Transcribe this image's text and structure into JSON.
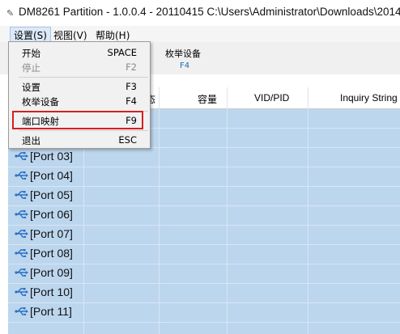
{
  "window": {
    "title": "DM8261 Partition - 1.0.0.4 - 20110415  C:\\Users\\Administrator\\Downloads\\2014"
  },
  "menubar": {
    "items": [
      {
        "label": "设置(S)"
      },
      {
        "label": "视图(V)"
      },
      {
        "label": "帮助(H)"
      }
    ]
  },
  "toolbar": {
    "enumerate_label": "枚举设备",
    "enumerate_key": "F4"
  },
  "settings_menu": {
    "items": [
      {
        "label": "开始",
        "shortcut": "SPACE",
        "enabled": true
      },
      {
        "label": "停止",
        "shortcut": "F2",
        "enabled": false
      },
      {
        "label": "设置",
        "shortcut": "F3",
        "enabled": true
      },
      {
        "label": "枚举设备",
        "shortcut": "F4",
        "enabled": true
      },
      {
        "label": "端口映射",
        "shortcut": "F9",
        "enabled": true,
        "highlighted": true
      },
      {
        "label": "退出",
        "shortcut": "ESC",
        "enabled": true
      }
    ]
  },
  "table": {
    "columns": [
      "态",
      "容量",
      "VID/PID",
      "Inquiry String"
    ],
    "rows": [
      {
        "port": "[Port 03]"
      },
      {
        "port": "[Port 04]"
      },
      {
        "port": "[Port 05]"
      },
      {
        "port": "[Port 06]"
      },
      {
        "port": "[Port 07]"
      },
      {
        "port": "[Port 08]"
      },
      {
        "port": "[Port 09]"
      },
      {
        "port": "[Port 10]"
      },
      {
        "port": "[Port 11]"
      }
    ]
  },
  "colors": {
    "grid_bg": "#bcd6ee",
    "highlight_border": "#d42020",
    "usb_icon": "#2a6fc4"
  },
  "icons": [
    "app-icon",
    "usb-icon"
  ]
}
